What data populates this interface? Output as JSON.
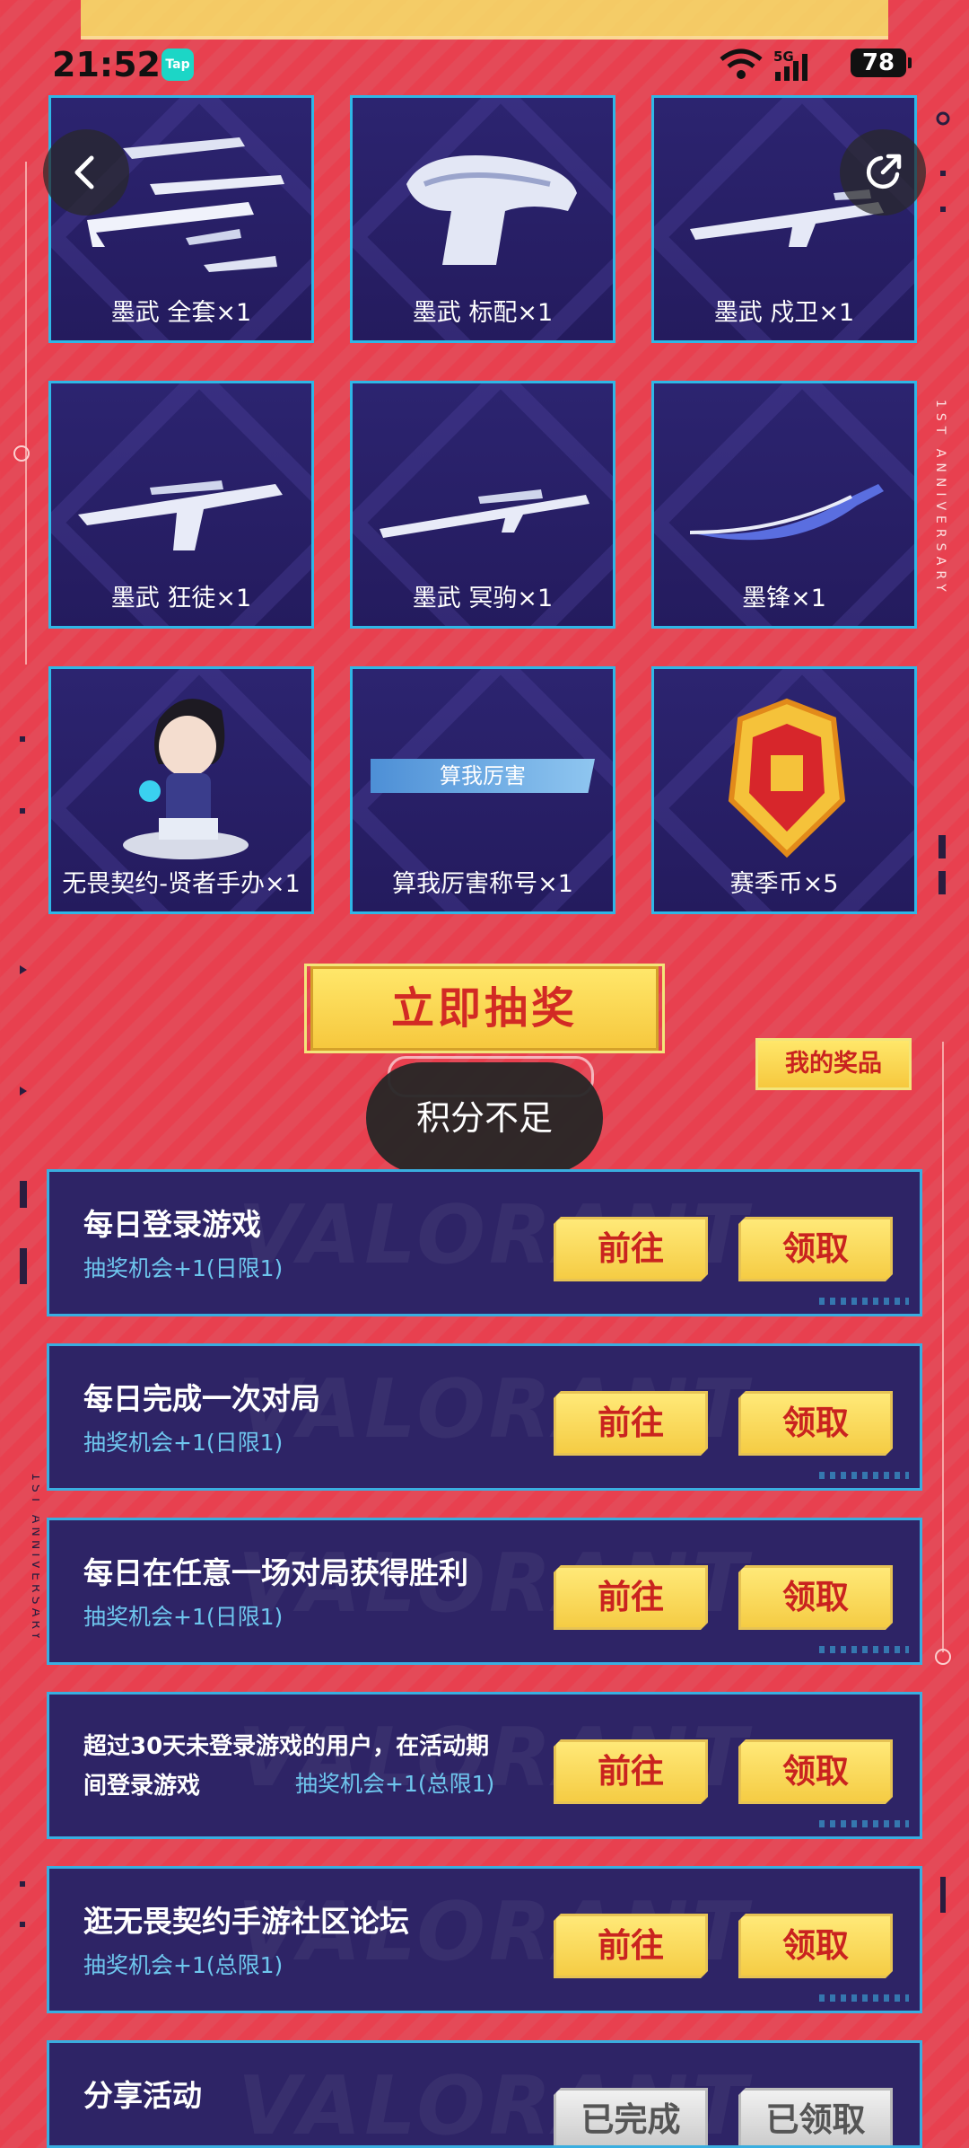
{
  "status": {
    "time": "21:52",
    "app_badge": "Tap",
    "network": "5G",
    "battery": "78"
  },
  "prizes": [
    {
      "label": "墨武 全套×1"
    },
    {
      "label": "墨武 标配×1"
    },
    {
      "label": "墨武 戍卫×1"
    },
    {
      "label": "墨武 狂徒×1"
    },
    {
      "label": "墨武 冥驹×1"
    },
    {
      "label": "墨锋×1"
    },
    {
      "label": "无畏契约-贤者手办×1"
    },
    {
      "label": "算我厉害称号×1",
      "title_strip": "算我厉害"
    },
    {
      "label": "赛季币×5"
    }
  ],
  "side_text": {
    "right": "1ST ANNIVERSARY",
    "left": "1ST ANNIVERSARY"
  },
  "draw_button": "立即抽奖",
  "my_prizes_button": "我的奖品",
  "toast": "积分不足",
  "tasks": [
    {
      "title": "每日登录游戏",
      "sub": "抽奖机会+1(日限1)",
      "go": "前往",
      "get": "领取"
    },
    {
      "title": "每日完成一次对局",
      "sub": "抽奖机会+1(日限1)",
      "go": "前往",
      "get": "领取"
    },
    {
      "title": "每日在任意一场对局获得胜利",
      "sub": "抽奖机会+1(日限1)",
      "go": "前往",
      "get": "领取"
    },
    {
      "title": "超过30天未登录游戏的用户，在活动期间登录游戏",
      "sub": "抽奖机会+1(总限1)",
      "go": "前往",
      "get": "领取"
    },
    {
      "title": "逛无畏契约手游社区论坛",
      "sub": "抽奖机会+1(总限1)",
      "go": "前往",
      "get": "领取"
    },
    {
      "title": "分享活动",
      "sub": "",
      "go": "已完成",
      "get": "已领取"
    }
  ],
  "watermark": "VALORANT",
  "colors": {
    "background": "#e8404f",
    "card": "#2c2470",
    "border": "#2fb7e6",
    "button": "#f6c83e",
    "button_text": "#c9231f"
  }
}
